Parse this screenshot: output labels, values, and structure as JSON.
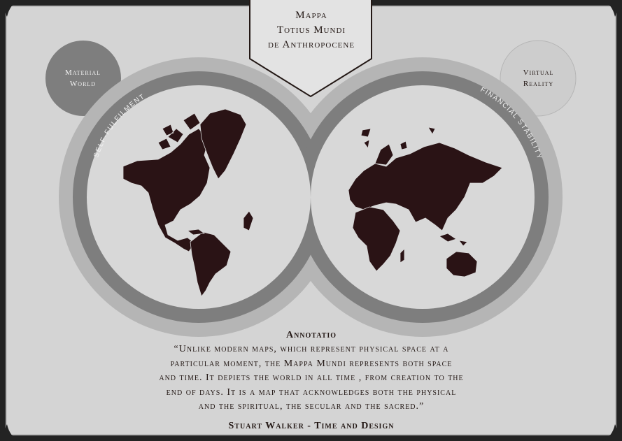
{
  "title_lines": [
    "Mappa",
    "Totius Mundi",
    "de Anthropocene"
  ],
  "left_bubble": [
    "Material",
    "World"
  ],
  "right_bubble": [
    "Virtual",
    "Reality"
  ],
  "ring_labels": {
    "left": "SELF-FULFILMENT",
    "right": "FINANCIAL STABILITY"
  },
  "annotation": {
    "heading": "Annotatio",
    "lines": [
      "“Unlike modern maps, which represent physical space at a",
      "particular moment, the Mappa Mundi represents both space",
      "and time. It depiets the world in all time , from creation to the",
      "end of days. It is a map that acknowledges both the physical",
      "and the spiritual, the secular and the sacred.”"
    ],
    "citation": "Stuart Walker - Time and Design"
  },
  "colors": {
    "page_background": "#d4d4d4",
    "frame_dark": "#232323",
    "outer_ring": "#b5b5b5",
    "inner_ring": "#7e7e7e",
    "globe_face": "#d8d8d8",
    "land": "#2a1315",
    "text": "#231815"
  }
}
